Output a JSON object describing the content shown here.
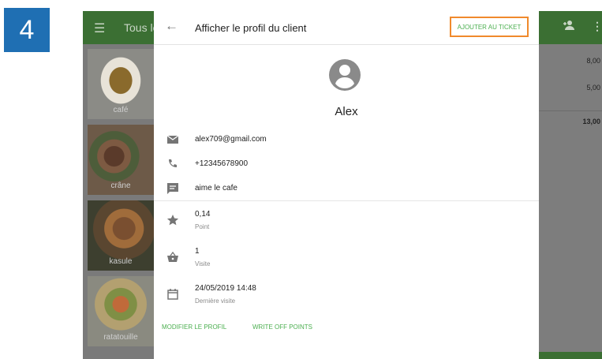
{
  "step": {
    "number": "4"
  },
  "background_app": {
    "menu_icon": "menu-icon",
    "title_partial": "Tous le",
    "header_icons": [
      "add-person-icon",
      "more-vert-icon"
    ],
    "amounts": [
      "8,00",
      "5,00"
    ],
    "total": "13,00",
    "tiles": [
      {
        "label": "café"
      },
      {
        "label": "crâne"
      },
      {
        "label": "kasule"
      },
      {
        "label": "ratatouille"
      }
    ]
  },
  "dialog": {
    "title": "Afficher le profil du client",
    "add_to_ticket": "AJOUTER AU TICKET",
    "customer_name": "Alex",
    "email": "alex709@gmail.com",
    "phone": "+12345678900",
    "note": "aime le cafe",
    "points_value": "0,14",
    "points_label": "Point",
    "visits_value": "1",
    "visits_label": "Visite",
    "last_visit_value": "24/05/2019 14:48",
    "last_visit_label": "Dernière visite",
    "edit_profile": "MODIFIER LE PROFIL",
    "write_off": "WRITE OFF POINTS"
  },
  "colors": {
    "accent_green": "#4caf50",
    "highlight_orange": "#f08a2c",
    "step_blue": "#1f6fb3"
  }
}
